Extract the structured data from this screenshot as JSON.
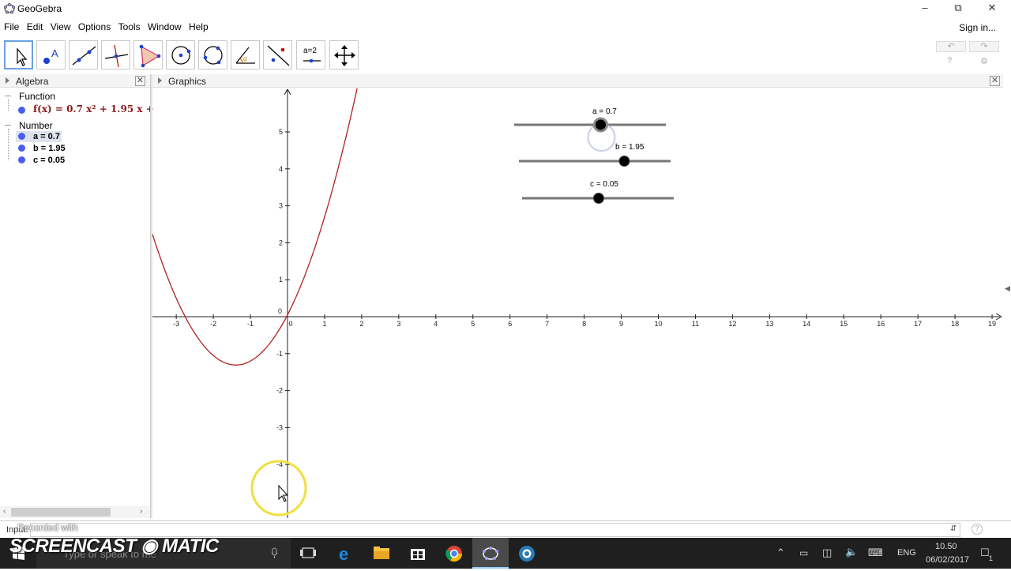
{
  "window": {
    "title": "GeoGebra"
  },
  "menu": {
    "items": [
      "File",
      "Edit",
      "View",
      "Options",
      "Tools",
      "Window",
      "Help"
    ],
    "sign_in": "Sign in..."
  },
  "toolbar": {
    "tools": [
      "move",
      "point",
      "line",
      "perpendicular-line",
      "polygon",
      "circle-center",
      "circle-3-points",
      "angle",
      "reflect",
      "slider",
      "move-graphics-view"
    ],
    "slider_tool_text": "a=2"
  },
  "algebra": {
    "title": "Algebra",
    "categories": {
      "function": "Function",
      "number": "Number"
    },
    "function_text": "f(x) = 0.7 x² + 1.95 x +",
    "numbers": [
      "a = 0.7",
      "b = 1.95",
      "c = 0.05"
    ]
  },
  "graphics": {
    "title": "Graphics",
    "x_tick_labels": [
      "-3",
      "-2",
      "-1",
      "0",
      "1",
      "2",
      "3",
      "4",
      "5",
      "6",
      "7",
      "8",
      "9",
      "10",
      "11",
      "12",
      "13",
      "14",
      "15",
      "16",
      "17",
      "18",
      "19"
    ],
    "y_tick_labels": [
      "5",
      "4",
      "3",
      "2",
      "1",
      "-1",
      "-2",
      "-3",
      "-4"
    ],
    "curve_color": "#b22222",
    "sliders": [
      {
        "label": "a = 0.7",
        "value": 0.7,
        "min": -5,
        "max": 5
      },
      {
        "label": "b = 1.95",
        "value": 1.95,
        "min": -5,
        "max": 5
      },
      {
        "label": "c = 0.05",
        "value": 0.05,
        "min": -5,
        "max": 5
      }
    ]
  },
  "input_bar": {
    "label": "Input:"
  },
  "overlay": {
    "recorded": "Recorded with",
    "brand": "SCREENCAST ◉ MATIC"
  },
  "taskbar": {
    "search_placeholder": "Type or speak to me",
    "language": "ENG",
    "time": "10.50",
    "date": "06/02/2017",
    "notifications": "1"
  }
}
